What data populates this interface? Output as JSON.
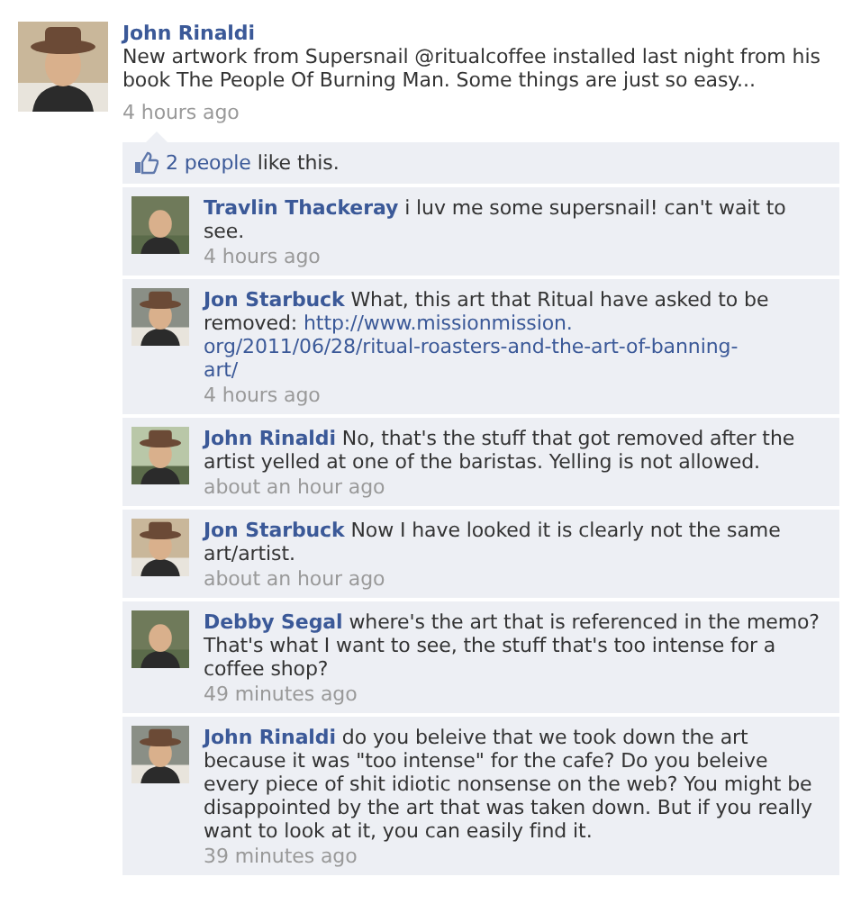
{
  "post": {
    "author": "John Rinaldi",
    "text": "New artwork from Supersnail @ritualcoffee installed last night from his book The People Of Burning Man. Some things are just so easy...",
    "time": "4 hours ago"
  },
  "likes": {
    "link": "2 people",
    "text": "like this."
  },
  "comments": [
    {
      "author": "Travlin Thackeray",
      "body": [
        {
          "kind": "text",
          "text": "i luv me some supersnail! can't wait to see."
        }
      ],
      "time": "4 hours ago"
    },
    {
      "author": "Jon Starbuck",
      "body": [
        {
          "kind": "text",
          "text": "What, this art that Ritual have asked to be removed:"
        },
        {
          "kind": "link",
          "text": "http://www.missionmission."
        },
        {
          "kind": "link",
          "text": "org/2011/06/28/ritual-roasters-and-the-art-of-banning-"
        },
        {
          "kind": "link",
          "text": "art/"
        }
      ],
      "time": "4 hours ago"
    },
    {
      "author": "John Rinaldi",
      "body": [
        {
          "kind": "text",
          "text": "No, that's the stuff that got removed after the artist yelled at one of the baristas. Yelling is not allowed."
        }
      ],
      "time": "about an hour ago"
    },
    {
      "author": "Jon Starbuck",
      "body": [
        {
          "kind": "text",
          "text": "Now I have looked it is clearly not the same art/artist."
        }
      ],
      "time": "about an hour ago"
    },
    {
      "author": "Debby Segal",
      "body": [
        {
          "kind": "text",
          "text": "where's the art that is referenced in the memo? That's what I want to see, the stuff that's too intense for a coffee shop?"
        }
      ],
      "time": "49 minutes ago"
    },
    {
      "author": "John Rinaldi",
      "body": [
        {
          "kind": "text",
          "text": "do you beleive that we took down the art because it was \"too intense\" for the cafe? Do you beleive every piece of shit idiotic nonsense on the web? You might be disappointed by the art that was taken down. But if you really want to look at it, you can easily find it."
        }
      ],
      "time": "39 minutes ago"
    }
  ]
}
